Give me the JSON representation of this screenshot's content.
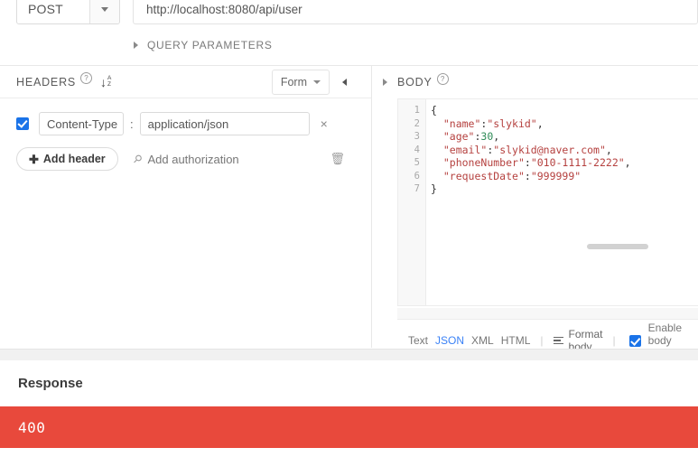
{
  "request": {
    "method": "POST",
    "url": "http://localhost:8080/api/user",
    "query_parameters_label": "QUERY PARAMETERS"
  },
  "headers_panel": {
    "title": "HEADERS",
    "help_glyph": "?",
    "sort_arrow": "↓",
    "sort_a": "A",
    "sort_z": "Z",
    "view_mode": "Form",
    "rows": [
      {
        "key": "Content-Type",
        "separator": ":",
        "value": "application/json",
        "remove": "×",
        "enabled": true
      }
    ],
    "add_header_label": "Add header",
    "add_header_plus": "✚",
    "add_authorization_label": "Add authorization",
    "key_icon_glyph": "⚲",
    "trash_icon_glyph": "🗑"
  },
  "body_panel": {
    "title": "BODY",
    "help_glyph": "?",
    "line_numbers": [
      "1",
      "2",
      "3",
      "4",
      "5",
      "6",
      "7"
    ],
    "code_lines": [
      {
        "indent": "",
        "parts": [
          {
            "t": "{",
            "c": "punc"
          }
        ]
      },
      {
        "indent": "  ",
        "parts": [
          {
            "t": "\"name\"",
            "c": "str"
          },
          {
            "t": ":",
            "c": "punc"
          },
          {
            "t": "\"slykid\"",
            "c": "str"
          },
          {
            "t": ",",
            "c": "punc"
          }
        ]
      },
      {
        "indent": "  ",
        "parts": [
          {
            "t": "\"age\"",
            "c": "str"
          },
          {
            "t": ":",
            "c": "punc"
          },
          {
            "t": "30",
            "c": "num"
          },
          {
            "t": ",",
            "c": "punc"
          }
        ]
      },
      {
        "indent": "  ",
        "parts": [
          {
            "t": "\"email\"",
            "c": "str"
          },
          {
            "t": ":",
            "c": "punc"
          },
          {
            "t": "\"slykid@naver.com\"",
            "c": "str"
          },
          {
            "t": ",",
            "c": "punc"
          }
        ]
      },
      {
        "indent": "  ",
        "parts": [
          {
            "t": "\"phoneNumber\"",
            "c": "str"
          },
          {
            "t": ":",
            "c": "punc"
          },
          {
            "t": "\"010-1111-2222\"",
            "c": "str"
          },
          {
            "t": ",",
            "c": "punc"
          }
        ]
      },
      {
        "indent": "  ",
        "parts": [
          {
            "t": "\"requestDate\"",
            "c": "str"
          },
          {
            "t": ":",
            "c": "punc"
          },
          {
            "t": "\"999999\"",
            "c": "str"
          }
        ]
      },
      {
        "indent": "",
        "parts": [
          {
            "t": "}",
            "c": "punc"
          }
        ]
      }
    ],
    "toolbar": {
      "formats": [
        "Text",
        "JSON",
        "XML",
        "HTML"
      ],
      "active_format": "JSON",
      "format_body_label": "Format body",
      "enable_body_evaluation_label": "Enable body evaluation",
      "enable_body_evaluation_checked": true,
      "separator": "|"
    }
  },
  "response": {
    "title": "Response",
    "status_code": "400",
    "status_color": "#e8493c"
  },
  "colors": {
    "accent_blue": "#1a73e8",
    "json_string": "#b5413f",
    "json_number": "#2e8b57",
    "error_red": "#e8493c"
  }
}
